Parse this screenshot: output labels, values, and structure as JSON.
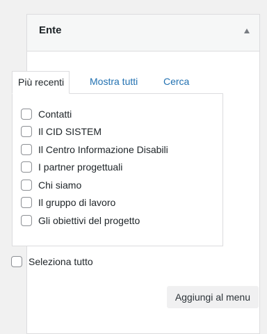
{
  "metabox": {
    "title": "Ente"
  },
  "tabs": [
    {
      "label": "Più recenti"
    },
    {
      "label": "Mostra tutti"
    },
    {
      "label": "Cerca"
    }
  ],
  "items": [
    {
      "label": "Contatti",
      "checked": false
    },
    {
      "label": "Il CID SISTEM",
      "checked": false
    },
    {
      "label": "Il Centro Informazione Disabili",
      "checked": false
    },
    {
      "label": "I partner progettuali",
      "checked": false
    },
    {
      "label": "Chi siamo",
      "checked": false
    },
    {
      "label": "Il gruppo di lavoro",
      "checked": false
    },
    {
      "label": "Gli obiettivi del progetto",
      "checked": false
    }
  ],
  "select_all": {
    "label": "Seleziona tutto",
    "checked": false
  },
  "add_button": {
    "label": "Aggiungi al menu"
  },
  "icons": {
    "toggle": "triangle-up-icon"
  },
  "colors": {
    "link": "#2271b1",
    "border": "#dcdcde",
    "background": "#f1f1f1"
  }
}
